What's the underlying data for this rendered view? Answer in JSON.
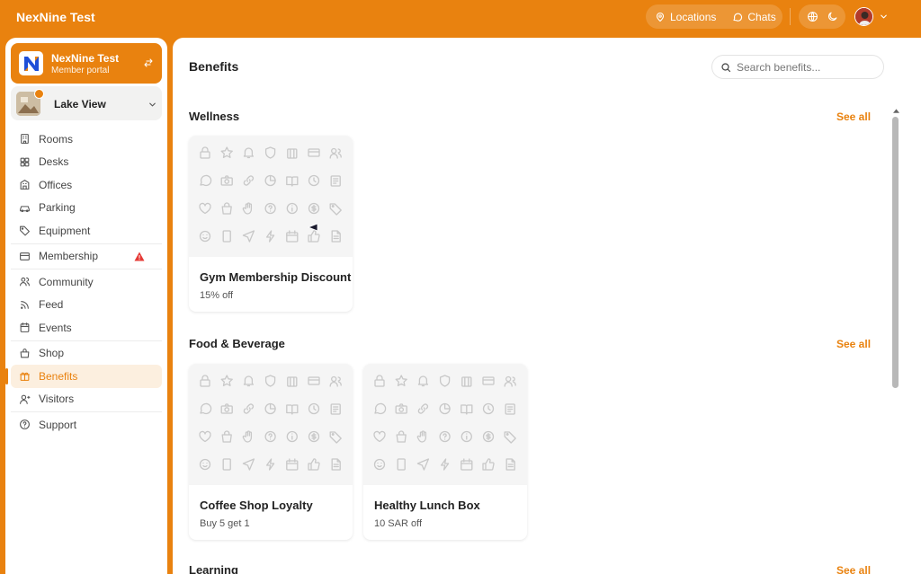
{
  "app": {
    "title": "NexNine Test"
  },
  "topbar": {
    "locations_label": "Locations",
    "chats_label": "Chats",
    "globe_icon": "globe-icon",
    "theme_icon": "moon-icon",
    "avatar_icon": "user-avatar",
    "menu_icon": "chevron-down-icon"
  },
  "sidebar": {
    "org": {
      "name": "NexNine Test",
      "subtitle": "Member portal",
      "switch_icon": "swap-icon"
    },
    "location": {
      "name": "Lake View"
    },
    "items": [
      {
        "label": "Rooms",
        "icon": "building-icon"
      },
      {
        "label": "Desks",
        "icon": "grid-icon"
      },
      {
        "label": "Offices",
        "icon": "office-icon"
      },
      {
        "label": "Parking",
        "icon": "car-icon"
      },
      {
        "label": "Equipment",
        "icon": "tag-icon"
      },
      {
        "label": "Membership",
        "icon": "card-icon",
        "warning": true
      },
      {
        "label": "Community",
        "icon": "users-icon"
      },
      {
        "label": "Feed",
        "icon": "rss-icon"
      },
      {
        "label": "Events",
        "icon": "calendar-icon"
      },
      {
        "label": "Shop",
        "icon": "shop-icon"
      },
      {
        "label": "Benefits",
        "icon": "gift-icon",
        "active": true
      },
      {
        "label": "Visitors",
        "icon": "visitor-icon"
      },
      {
        "label": "Support",
        "icon": "help-icon"
      }
    ]
  },
  "main": {
    "title": "Benefits",
    "search": {
      "placeholder": "Search benefits..."
    },
    "sections": [
      {
        "title": "Wellness",
        "see_all": "See all",
        "cards": [
          {
            "title": "Gym Membership Discount",
            "subtitle": "15% off"
          }
        ]
      },
      {
        "title": "Food & Beverage",
        "see_all": "See all",
        "cards": [
          {
            "title": "Coffee Shop Loyalty",
            "subtitle": "Buy 5 get 1"
          },
          {
            "title": "Healthy Lunch Box",
            "subtitle": "10 SAR off"
          }
        ]
      },
      {
        "title": "Learning",
        "see_all": "See all",
        "cards": []
      }
    ]
  },
  "colors": {
    "accent": "#E9820F",
    "warning": "#E53935",
    "pattern": "#C8C8C8"
  }
}
